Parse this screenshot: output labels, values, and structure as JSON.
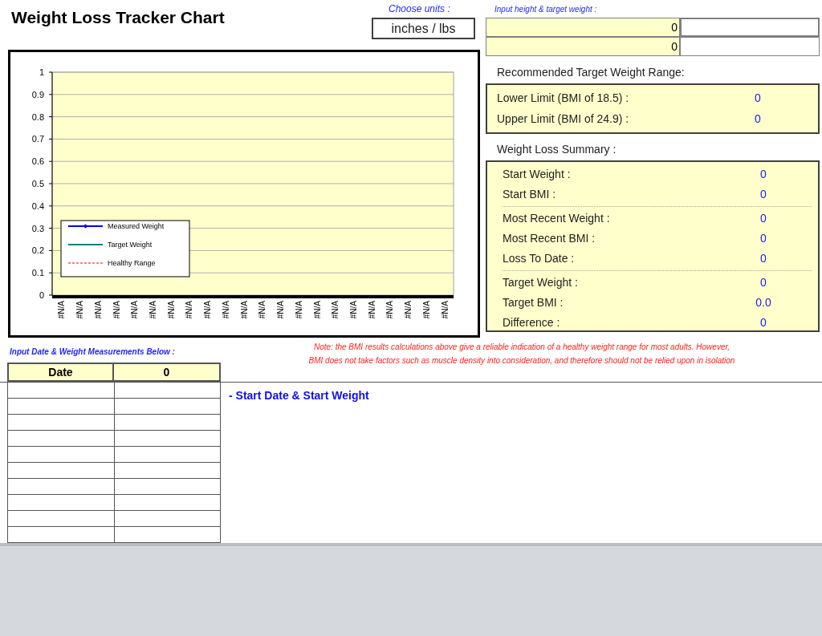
{
  "title": "Weight Loss Tracker Chart",
  "units": {
    "label": "Choose units :",
    "value": "inches / lbs"
  },
  "inputs": {
    "label": "Input height & target weight :",
    "rows": [
      {
        "value": "0"
      },
      {
        "value": "0"
      }
    ]
  },
  "chart_data": {
    "type": "line",
    "grid": true,
    "categories": [
      "#N/A",
      "#N/A",
      "#N/A",
      "#N/A",
      "#N/A",
      "#N/A",
      "#N/A",
      "#N/A",
      "#N/A",
      "#N/A",
      "#N/A",
      "#N/A",
      "#N/A",
      "#N/A",
      "#N/A",
      "#N/A",
      "#N/A",
      "#N/A",
      "#N/A",
      "#N/A",
      "#N/A",
      "#N/A"
    ],
    "ylim": [
      0,
      1
    ],
    "yticks": [
      {
        "value": 0,
        "label": "0"
      },
      {
        "value": 0.1,
        "label": "0.1"
      },
      {
        "value": 0.2,
        "label": "0.2"
      },
      {
        "value": 0.3,
        "label": "0.3"
      },
      {
        "value": 0.4,
        "label": "0.4"
      },
      {
        "value": 0.5,
        "label": "0.5"
      },
      {
        "value": 0.6,
        "label": "0.6"
      },
      {
        "value": 0.7,
        "label": "0.7"
      },
      {
        "value": 0.8,
        "label": "0.8"
      },
      {
        "value": 0.9,
        "label": "0.9"
      },
      {
        "value": 1,
        "label": "1"
      }
    ],
    "series": [
      {
        "name": "Measured Weight",
        "color": "#0000ff",
        "values": [
          null,
          null,
          null,
          null,
          null,
          null,
          null,
          null,
          null,
          null,
          null,
          null,
          null,
          null,
          null,
          null,
          null,
          null,
          null,
          null,
          null,
          null
        ]
      },
      {
        "name": "Target Weight",
        "color": "#008080",
        "values": [
          null,
          null,
          null,
          null,
          null,
          null,
          null,
          null,
          null,
          null,
          null,
          null,
          null,
          null,
          null,
          null,
          null,
          null,
          null,
          null,
          null,
          null
        ]
      },
      {
        "name": "Healthy Range",
        "color": "#ff0000",
        "values": [
          null,
          null,
          null,
          null,
          null,
          null,
          null,
          null,
          null,
          null,
          null,
          null,
          null,
          null,
          null,
          null,
          null,
          null,
          null,
          null,
          null,
          null
        ]
      }
    ]
  },
  "target_range": {
    "heading": "Recommended Target Weight Range:",
    "rows": [
      {
        "label": "Lower Limit (BMI of 18.5) :",
        "value": "0"
      },
      {
        "label": "Upper Limit (BMI of 24.9) :",
        "value": "0"
      }
    ]
  },
  "summary": {
    "heading": "Weight Loss Summary :",
    "groups": [
      {
        "rows": [
          {
            "label": "Start Weight :",
            "value": "0"
          },
          {
            "label": "Start BMI :",
            "value": "0"
          }
        ]
      },
      {
        "rows": [
          {
            "label": "Most Recent Weight :",
            "value": "0"
          },
          {
            "label": "Most Recent BMI :",
            "value": "0"
          },
          {
            "label": "Loss To Date :",
            "value": "0"
          }
        ]
      },
      {
        "rows": [
          {
            "label": "Target Weight :",
            "value": "0"
          },
          {
            "label": "Target BMI :",
            "value": "0.0"
          },
          {
            "label": "Difference :",
            "value": "0"
          }
        ]
      }
    ]
  },
  "measurements": {
    "label": "Input Date & Weight Measurements Below :",
    "columns": [
      "Date",
      "0"
    ]
  },
  "note": [
    "Note: the BMI results calculations above give a reliable indication of a healthy weight range for most adults. However,",
    "BMI does not take factors such as muscle density into consideration, and therefore should not be relied upon in isolation"
  ],
  "start_marker": "- Start Date & Start Weight"
}
